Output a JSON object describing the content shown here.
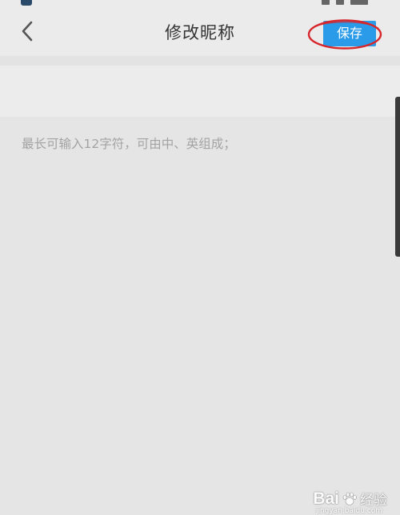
{
  "header": {
    "title": "修改昵称",
    "save_label": "保存",
    "back_icon": "chevron-left-icon"
  },
  "nickname": {
    "value": "",
    "placeholder": ""
  },
  "hint": "最长可输入12字符，可由中、英组成；",
  "watermark": {
    "logo": "Bai",
    "text": "经验",
    "url": "jingyan.baidu.com"
  },
  "colors": {
    "accent": "#2a9be8",
    "highlight_circle": "#d7262b",
    "background": "#e5e5e5",
    "nav_background": "#ebebeb",
    "hint_text": "#a3a3a3"
  }
}
